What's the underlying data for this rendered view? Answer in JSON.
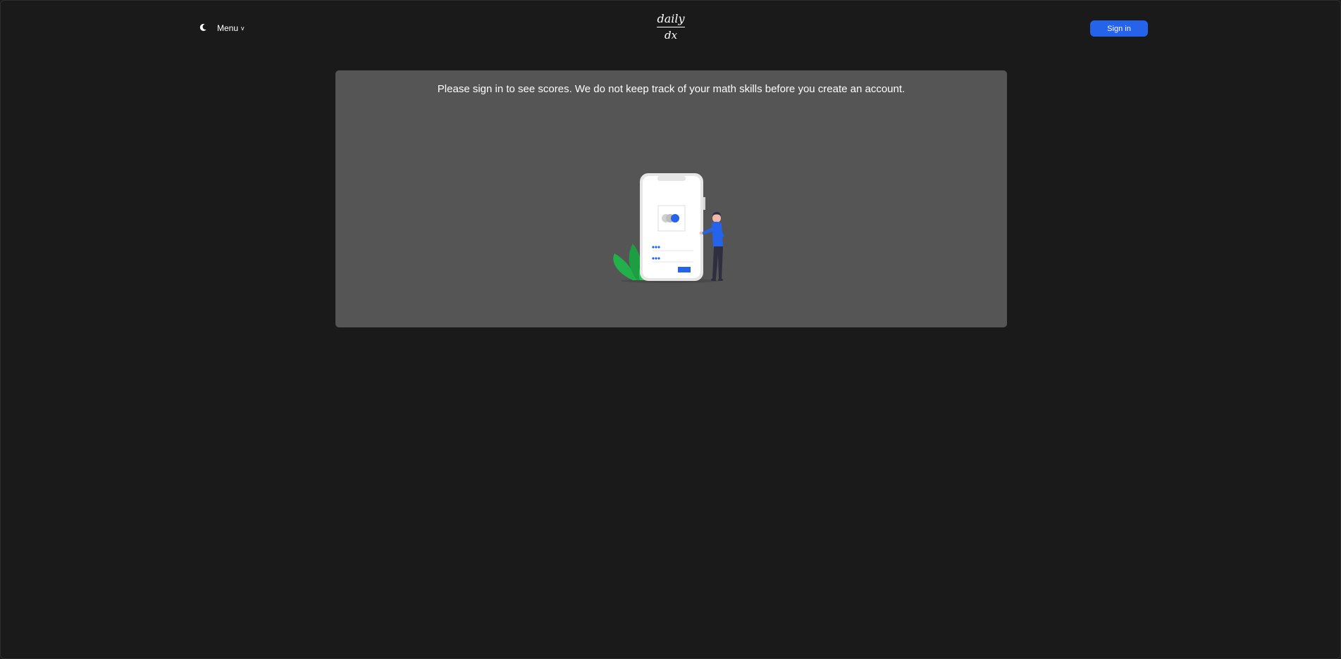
{
  "header": {
    "theme_icon": "moon-icon",
    "menu_label": "Menu",
    "menu_chevron": "v",
    "logo": {
      "numerator": "daily",
      "denominator": "dx"
    },
    "signin_label": "Sign in"
  },
  "main": {
    "message": "Please sign in to see scores. We do not keep track of your math skills before you create an account.",
    "illustration": "person-with-phone-login-illustration"
  },
  "colors": {
    "background": "#1a1a1a",
    "panel": "#555555",
    "accent": "#2563eb",
    "leaf": "#22b04b",
    "text": "#ffffff"
  }
}
